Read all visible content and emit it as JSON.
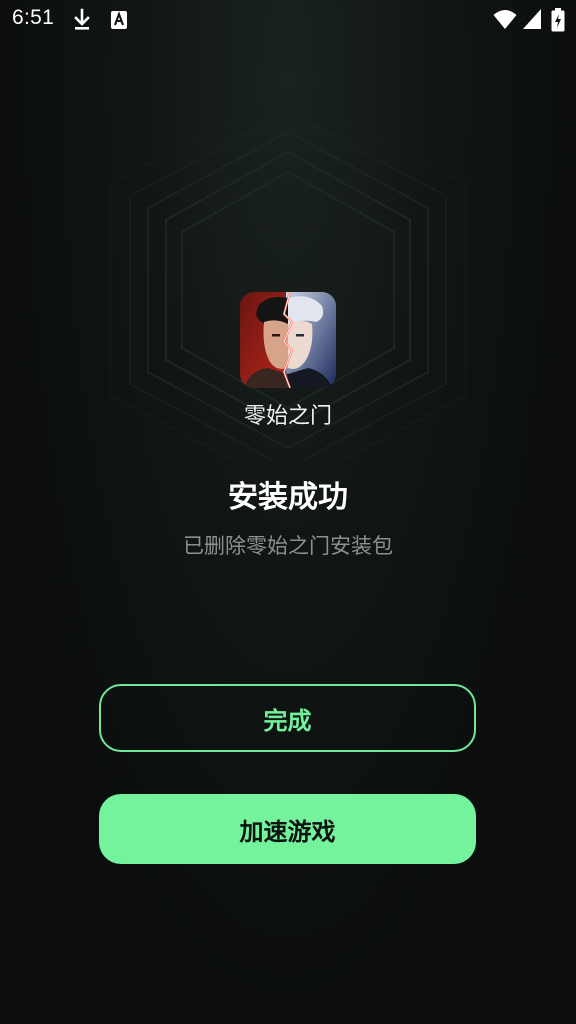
{
  "status_bar": {
    "time": "6:51",
    "icons": [
      "download-icon",
      "a-icon",
      "wifi-icon",
      "signal-icon",
      "battery-charging-icon"
    ]
  },
  "app": {
    "name": "零始之门",
    "icon": "app-icon-零始之门"
  },
  "result": {
    "title": "安装成功",
    "subtitle": "已删除零始之门安装包"
  },
  "buttons": {
    "done_label": "完成",
    "boost_label": "加速游戏"
  },
  "colors": {
    "accent": "#75f39c",
    "background": "#0b0e0d",
    "subtitle": "#8c918f"
  }
}
